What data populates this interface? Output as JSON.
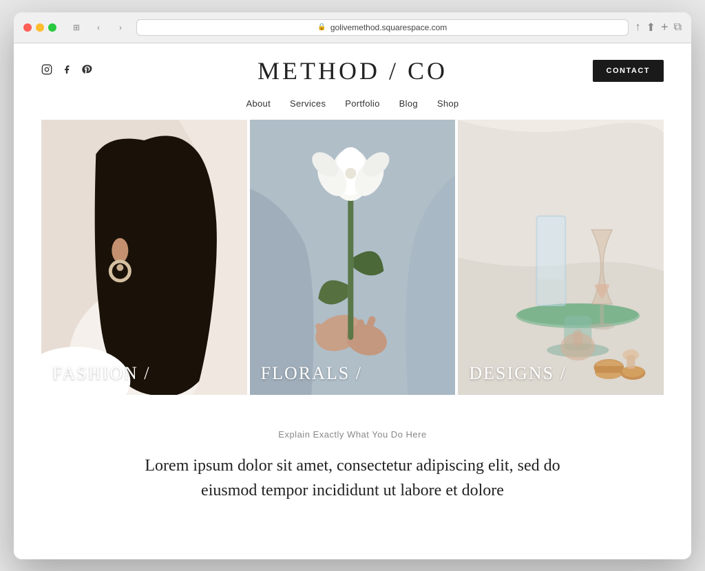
{
  "browser": {
    "url": "golivemethod.squarespace.com",
    "reload_label": "⟳"
  },
  "header": {
    "logo": "METHOD / CO",
    "contact_button": "CONTACT",
    "social_icons": {
      "instagram": "instagram-icon",
      "facebook": "facebook-icon",
      "pinterest": "pinterest-icon"
    },
    "nav_items": [
      {
        "label": "About",
        "id": "about"
      },
      {
        "label": "Services",
        "id": "services"
      },
      {
        "label": "Portfolio",
        "id": "portfolio"
      },
      {
        "label": "Blog",
        "id": "blog"
      },
      {
        "label": "Shop",
        "id": "shop"
      }
    ]
  },
  "grid": {
    "items": [
      {
        "label": "FASHION /",
        "id": "fashion"
      },
      {
        "label": "FLORALS /",
        "id": "florals"
      },
      {
        "label": "DESIGNS /",
        "id": "designs"
      }
    ]
  },
  "content": {
    "subtitle": "Explain Exactly What You Do Here",
    "body_text": "Lorem ipsum dolor sit amet, consectetur adipiscing elit, sed do eiusmod tempor incididunt ut labore et dolore"
  }
}
